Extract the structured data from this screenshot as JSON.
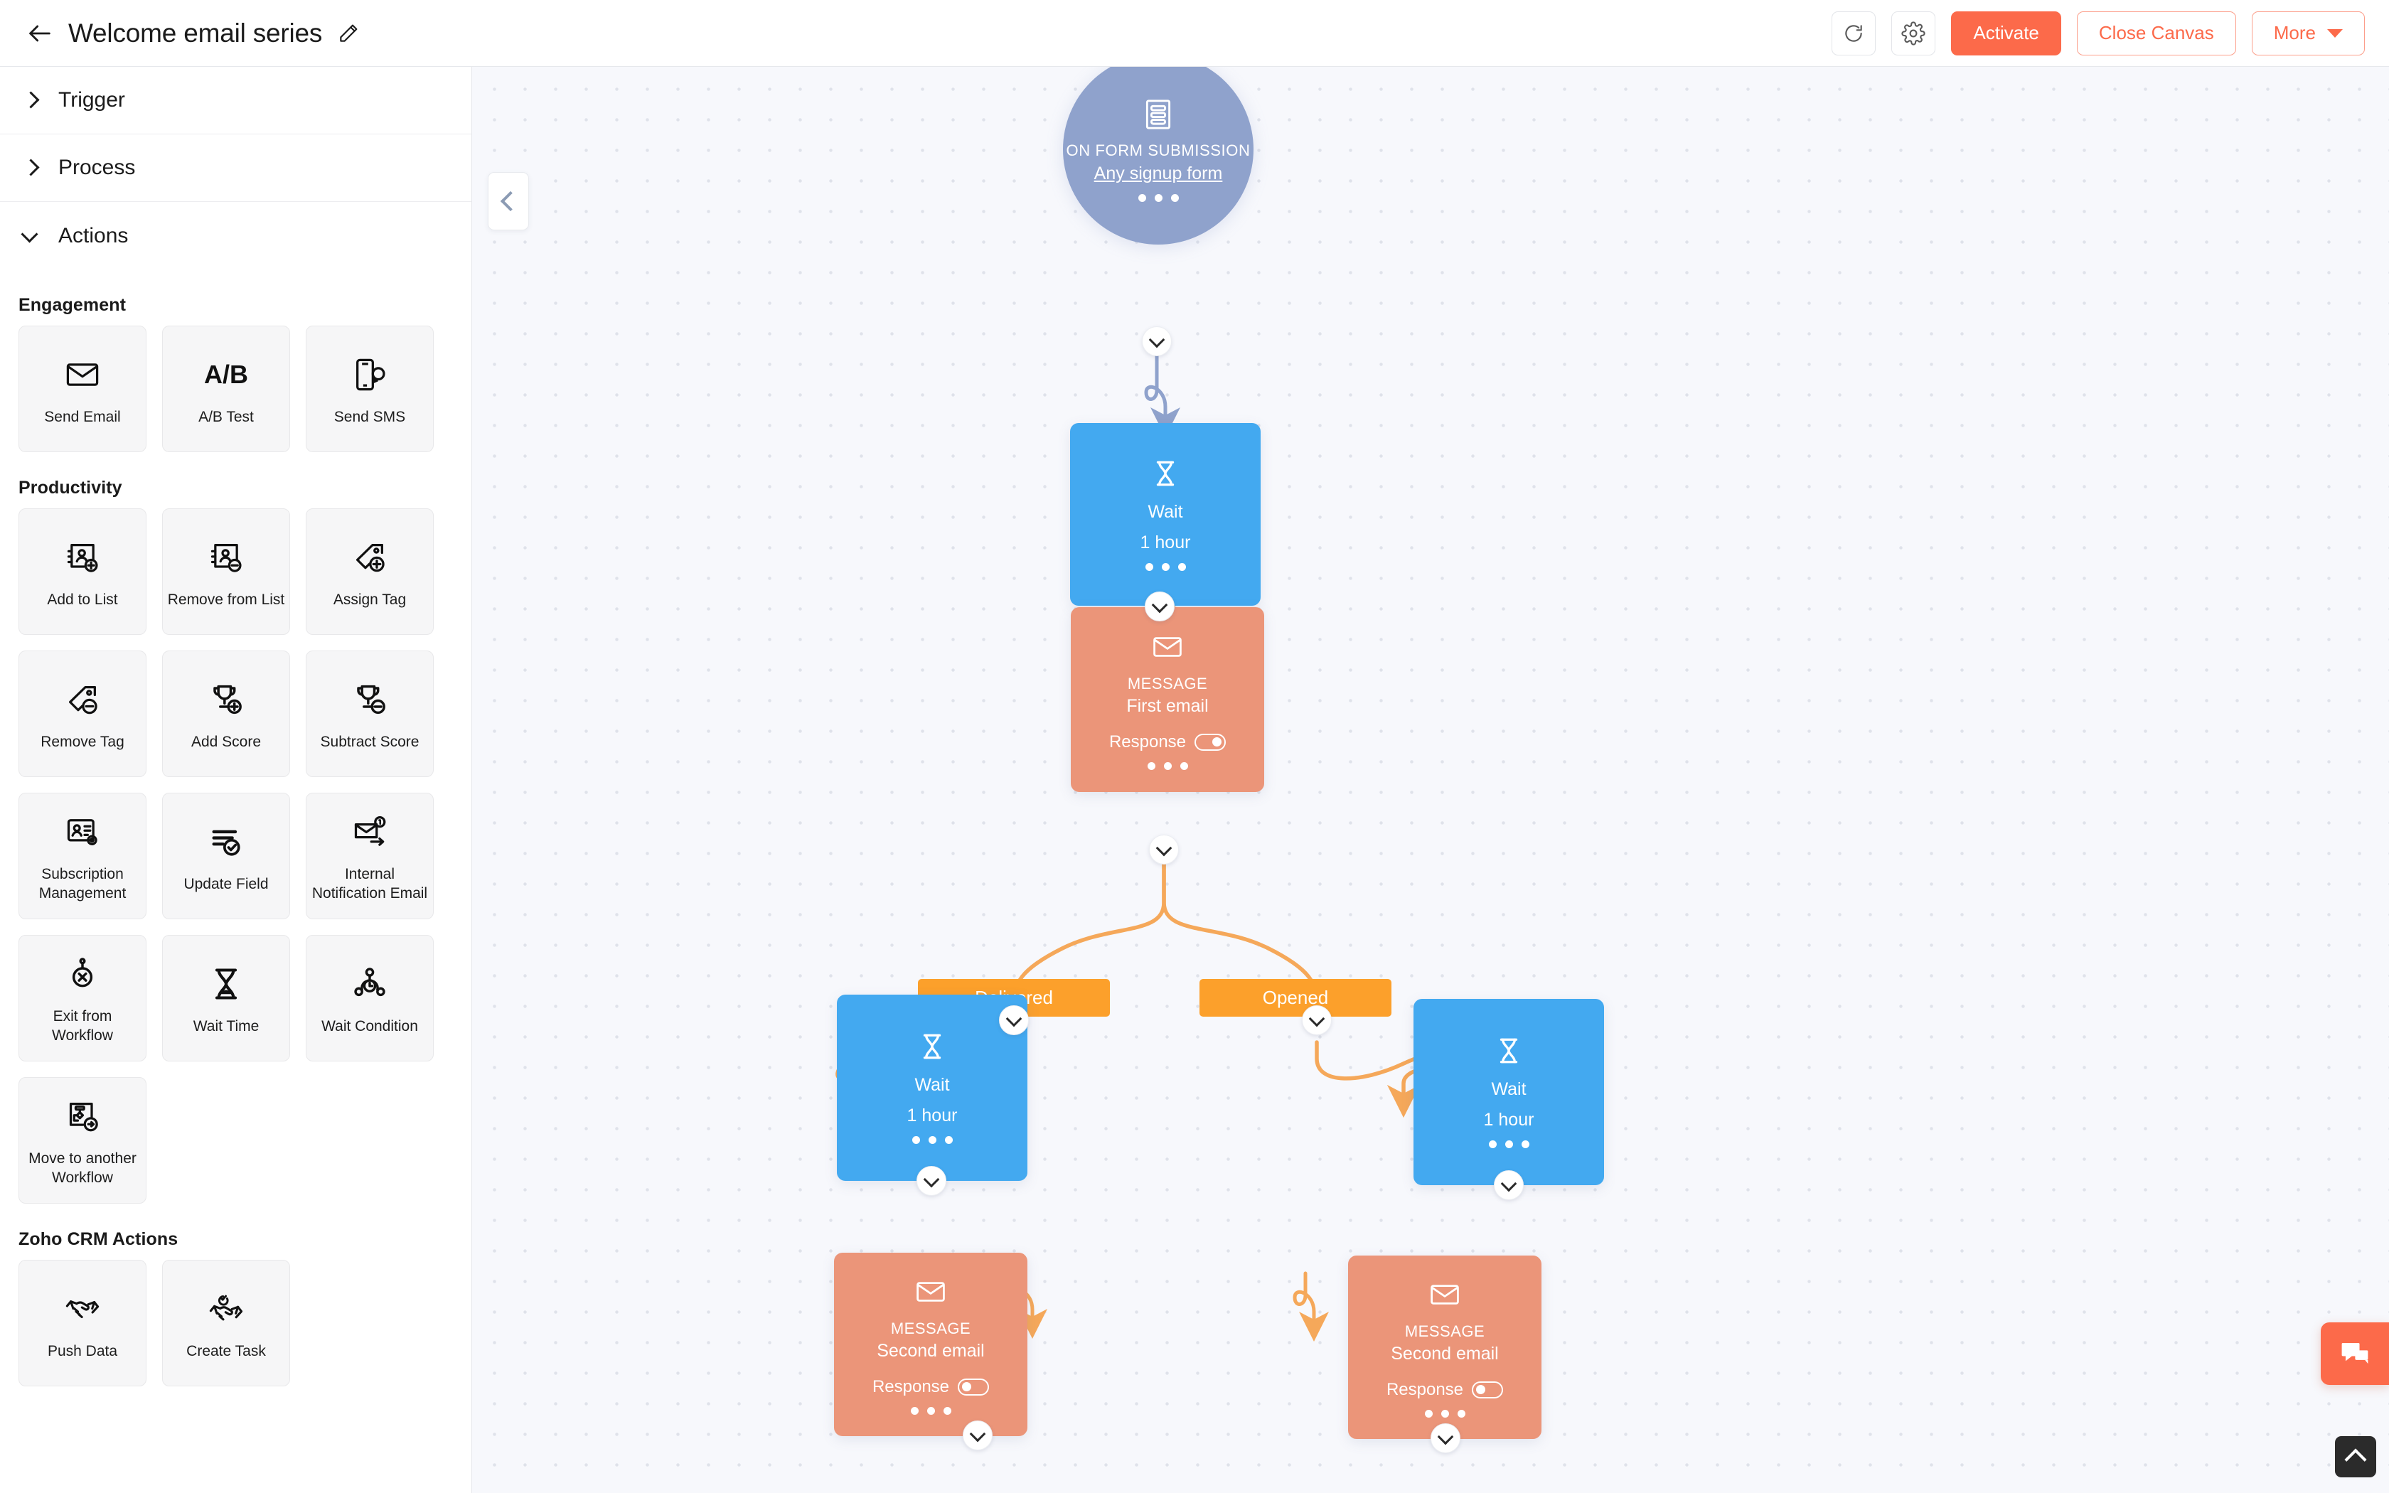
{
  "header": {
    "back_icon": "back-arrow-icon",
    "title": "Welcome email series",
    "edit_icon": "pencil-icon",
    "refresh_icon": "refresh-icon",
    "settings_icon": "gear-icon",
    "activate_label": "Activate",
    "close_canvas_label": "Close Canvas",
    "more_label": "More"
  },
  "sidebar": {
    "accordions": [
      {
        "label": "Trigger",
        "expanded": false
      },
      {
        "label": "Process",
        "expanded": false
      },
      {
        "label": "Actions",
        "expanded": true
      }
    ],
    "groups": [
      {
        "title": "Engagement",
        "items": [
          {
            "label": "Send Email",
            "icon": "envelope-icon"
          },
          {
            "label": "A/B Test",
            "icon": "ab-test-icon"
          },
          {
            "label": "Send SMS",
            "icon": "mobile-message-icon"
          }
        ]
      },
      {
        "title": "Productivity",
        "items": [
          {
            "label": "Add to List",
            "icon": "contact-card-plus-icon"
          },
          {
            "label": "Remove from List",
            "icon": "contact-card-minus-icon"
          },
          {
            "label": "Assign Tag",
            "icon": "tag-plus-icon"
          },
          {
            "label": "Remove Tag",
            "icon": "tag-minus-icon"
          },
          {
            "label": "Add Score",
            "icon": "trophy-plus-icon"
          },
          {
            "label": "Subtract Score",
            "icon": "trophy-minus-icon"
          },
          {
            "label": "Subscription Management",
            "icon": "contact-settings-icon"
          },
          {
            "label": "Update Field",
            "icon": "list-check-icon"
          },
          {
            "label": "Internal Notification Email",
            "icon": "envelope-notify-icon"
          },
          {
            "label": "Exit from Workflow",
            "icon": "exit-circle-icon"
          },
          {
            "label": "Wait Time",
            "icon": "hourglass-icon"
          },
          {
            "label": "Wait Condition",
            "icon": "branch-clock-icon"
          },
          {
            "label": "Move to another Workflow",
            "icon": "move-workflow-icon"
          }
        ]
      },
      {
        "title": "Zoho CRM Actions",
        "items": [
          {
            "label": "Push Data",
            "icon": "handshake-icon"
          },
          {
            "label": "Create Task",
            "icon": "handshake-check-icon"
          }
        ]
      }
    ]
  },
  "canvas": {
    "collapse_icon": "chevron-left-icon",
    "trigger": {
      "icon": "form-icon",
      "kind": "ON FORM SUBMISSION",
      "link": "Any signup form"
    },
    "nodes": [
      {
        "id": "wait-1",
        "type": "wait",
        "icon": "hourglass-icon",
        "title": "Wait",
        "sub": "1 hour"
      },
      {
        "id": "msg-1",
        "type": "message",
        "icon": "envelope-icon",
        "kind": "MESSAGE",
        "name": "First email",
        "response_label": "Response",
        "response_on": true
      },
      {
        "id": "branch-delivered",
        "type": "branch",
        "label": "Delivered"
      },
      {
        "id": "branch-opened",
        "type": "branch",
        "label": "Opened"
      },
      {
        "id": "wait-2",
        "type": "wait",
        "icon": "hourglass-icon",
        "title": "Wait",
        "sub": "1 hour"
      },
      {
        "id": "wait-3",
        "type": "wait",
        "icon": "hourglass-icon",
        "title": "Wait",
        "sub": "1 hour"
      },
      {
        "id": "msg-2",
        "type": "message",
        "icon": "envelope-icon",
        "kind": "MESSAGE",
        "name": "Second email",
        "response_label": "Response",
        "response_on": false
      },
      {
        "id": "msg-3",
        "type": "message",
        "icon": "envelope-icon",
        "kind": "MESSAGE",
        "name": "Second email",
        "response_label": "Response",
        "response_on": false
      }
    ]
  },
  "floating": {
    "chat_icon": "chat-bubbles-icon",
    "scroll_top_icon": "chevron-up-icon"
  },
  "colors": {
    "accent": "#fc6a4a",
    "trigger": "#8fa2cc",
    "wait": "#43a9f0",
    "message": "#eb9579",
    "branch": "#fca02b",
    "edge": "#f5a85a",
    "canvas_bg": "#f7f8fc"
  }
}
